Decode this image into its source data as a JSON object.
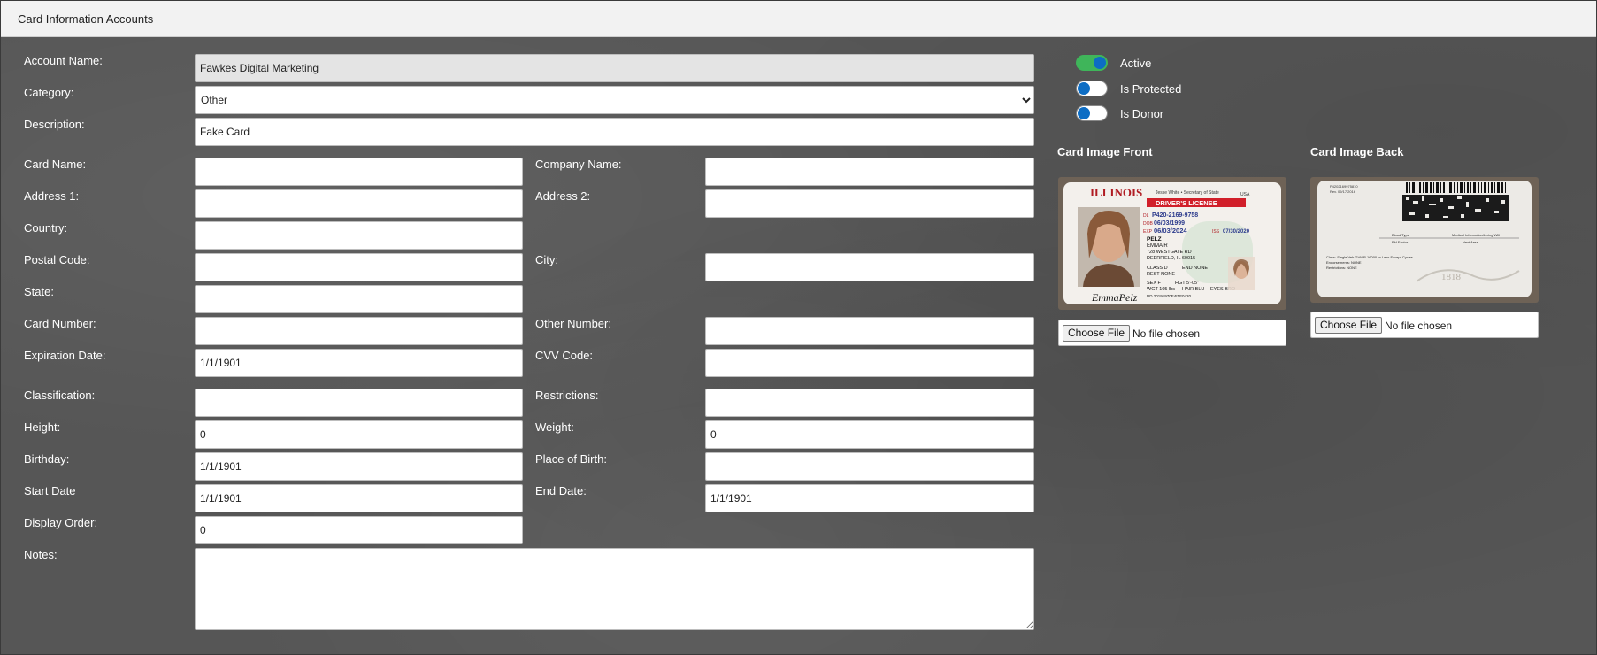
{
  "window": {
    "title": "Card Information Accounts"
  },
  "form": {
    "account_name": {
      "label": "Account Name:",
      "value": "Fawkes Digital Marketing"
    },
    "category": {
      "label": "Category:",
      "value": "Other",
      "options": [
        "Other"
      ]
    },
    "description": {
      "label": "Description:",
      "value": "Fake Card"
    },
    "card_name": {
      "label": "Card Name:",
      "value": ""
    },
    "company_name": {
      "label": "Company Name:",
      "value": ""
    },
    "address1": {
      "label": "Address 1:",
      "value": ""
    },
    "address2": {
      "label": "Address 2:",
      "value": ""
    },
    "country": {
      "label": "Country:",
      "value": ""
    },
    "postal_code": {
      "label": "Postal Code:",
      "value": ""
    },
    "city": {
      "label": "City:",
      "value": ""
    },
    "state": {
      "label": "State:",
      "value": ""
    },
    "card_number": {
      "label": "Card Number:",
      "value": ""
    },
    "other_number": {
      "label": "Other Number:",
      "value": ""
    },
    "expiration_date": {
      "label": "Expiration Date:",
      "value": "1/1/1901"
    },
    "cvv_code": {
      "label": "CVV Code:",
      "value": ""
    },
    "classification": {
      "label": "Classification:",
      "value": ""
    },
    "restrictions": {
      "label": "Restrictions:",
      "value": ""
    },
    "height": {
      "label": "Height:",
      "value": "0"
    },
    "weight": {
      "label": "Weight:",
      "value": "0"
    },
    "birthday": {
      "label": "Birthday:",
      "value": "1/1/1901"
    },
    "place_of_birth": {
      "label": "Place of Birth:",
      "value": ""
    },
    "start_date": {
      "label": "Start Date",
      "value": "1/1/1901"
    },
    "end_date": {
      "label": "End Date:",
      "value": "1/1/1901"
    },
    "display_order": {
      "label": "Display Order:",
      "value": "0"
    },
    "notes": {
      "label": "Notes:",
      "value": ""
    }
  },
  "toggles": {
    "active": {
      "label": "Active",
      "on": true
    },
    "is_protected": {
      "label": "Is Protected",
      "on": false
    },
    "is_donor": {
      "label": "Is Donor",
      "on": false
    }
  },
  "images": {
    "front": {
      "heading": "Card Image Front",
      "button": "Choose File",
      "file_status": "No file chosen",
      "card": {
        "state": "ILLINOIS",
        "issuer": "Jesse White • Secretary of State",
        "country": "USA",
        "type": "DRIVER'S LICENSE",
        "dl_prefix": "DL",
        "dl_number": "P420-2169-9758",
        "dob_prefix": "DOB",
        "dob": "06/03/1999",
        "exp_prefix": "EXP",
        "exp": "06/03/2024",
        "iss_prefix": "ISS",
        "iss": "07/30/2020",
        "last_name": "PELZ",
        "first_name": "EMMA R",
        "street": "728 WESTGATE RD",
        "city_line": "DEERFIELD, IL 60015",
        "class": "CLASS D",
        "end": "END NONE",
        "rest": "REST NONE",
        "sex": "SEX F",
        "hgt": "HGT 5'-05\"",
        "wgt": "WGT 105 lbs",
        "hair": "HAIR BLU",
        "eyes": "EYES BRO",
        "dd": "DD 20191970E4ITF0420",
        "signature": "EmmaPelz"
      },
      "accent": "#d11f2a"
    },
    "back": {
      "heading": "Card Image Back",
      "button": "Choose File",
      "file_status": "No file chosen",
      "card": {
        "top_left": "P4202169975810",
        "top_dates": "Rev. 09/17/2016",
        "blood": "Blood Type",
        "blood_val": "RH Factor",
        "medical": "Medical Information/Living Will",
        "medical_val": "Next Area",
        "class_line": "Class: Single Veh GVWR 16000 or Less Except Cycles",
        "endorse_line": "Endorsements: NONE",
        "restrict_line": "Restrictions: NONE",
        "serial": "1818"
      }
    }
  }
}
